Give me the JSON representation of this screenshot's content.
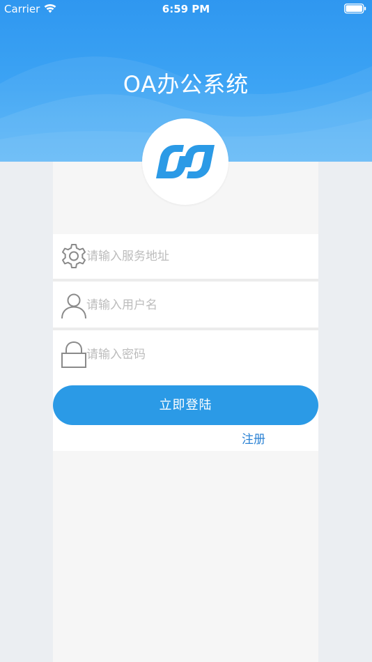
{
  "status_bar": {
    "carrier": "Carrier",
    "time": "6:59 PM",
    "wifi_icon": "wifi-icon",
    "battery_icon": "battery-icon"
  },
  "header": {
    "title": "OA办公系统",
    "logo_icon": "app-logo-icon"
  },
  "form": {
    "server": {
      "icon": "gear-icon",
      "value": "",
      "placeholder": "请输入服务地址"
    },
    "username": {
      "icon": "user-icon",
      "value": "",
      "placeholder": "请输入用户名"
    },
    "password": {
      "icon": "lock-icon",
      "value": "",
      "placeholder": "请输入密码"
    },
    "login_label": "立即登陆",
    "register_label": "注册"
  },
  "colors": {
    "header_blue": "#2f97f0",
    "button_blue": "#2b9ae6",
    "link_blue": "#2b82d4",
    "background": "#ebeef2",
    "card": "#f6f6f6",
    "placeholder": "#bcbcbc"
  }
}
